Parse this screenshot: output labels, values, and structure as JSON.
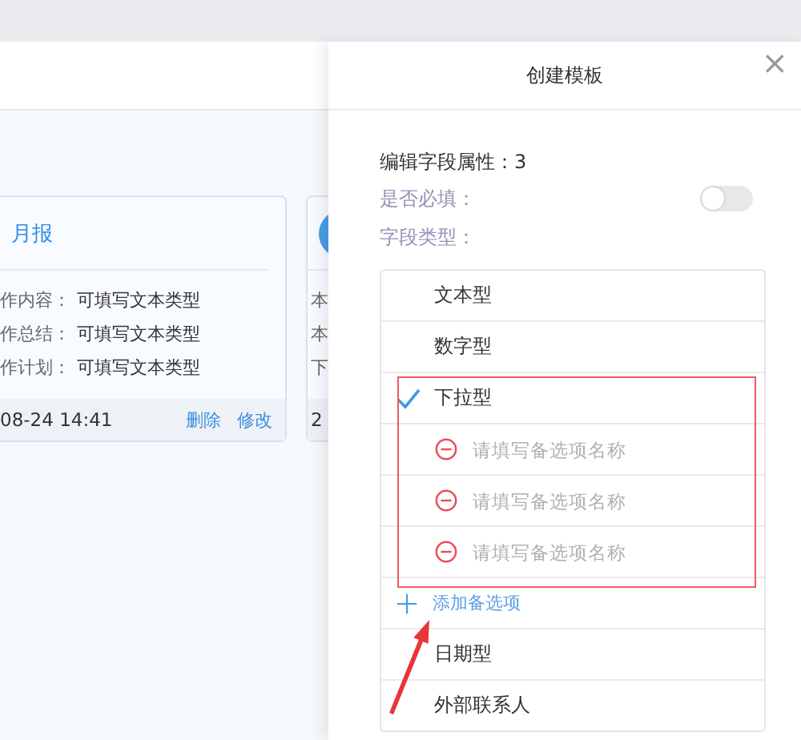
{
  "cards": [
    {
      "title": "月报",
      "rows": [
        {
          "label": "作内容：",
          "value": "可填写文本类型"
        },
        {
          "label": "作总结：",
          "value": "可填写文本类型"
        },
        {
          "label": "作计划：",
          "value": "可填写文本类型"
        }
      ],
      "time": "08-24 14:41",
      "actions": [
        "删除",
        "修改"
      ]
    },
    {
      "rows": [
        {
          "label": "本"
        },
        {
          "label": "本"
        },
        {
          "label": "下"
        }
      ],
      "time": "2"
    }
  ],
  "drawer": {
    "title": "创建模板",
    "close": "×",
    "heading": "编辑字段属性：3",
    "required_label": "是否必填：",
    "required": {
      "on": false
    },
    "type_label": "字段类型：",
    "field_types": [
      {
        "label": "文本型",
        "selected": false
      },
      {
        "label": "数字型",
        "selected": false
      },
      {
        "label": "下拉型",
        "selected": true,
        "options": [
          {
            "placeholder": "请填写备选项名称"
          },
          {
            "placeholder": "请填写备选项名称"
          },
          {
            "placeholder": "请填写备选项名称"
          }
        ],
        "add_option": "添加备选项"
      },
      {
        "label": "日期型",
        "selected": false
      },
      {
        "label": "外部联系人",
        "selected": false
      }
    ]
  }
}
